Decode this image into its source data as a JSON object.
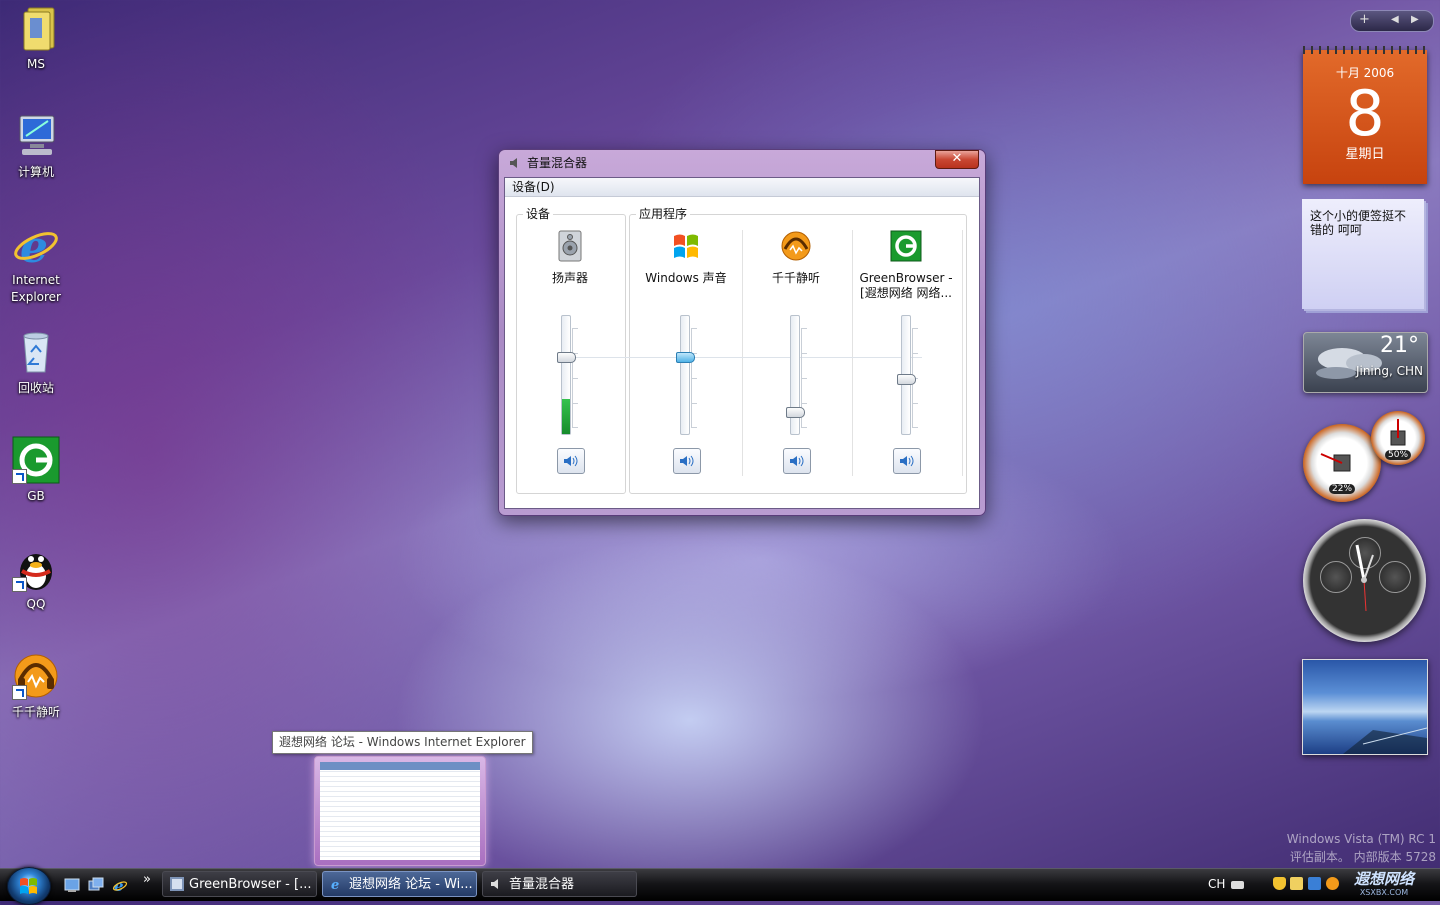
{
  "desktop": {
    "icons": [
      {
        "label": "MS"
      },
      {
        "label": "计算机"
      },
      {
        "label": "Internet Explorer"
      },
      {
        "label": "回收站"
      },
      {
        "label": "GB"
      },
      {
        "label": "QQ"
      },
      {
        "label": "千千静听"
      }
    ]
  },
  "sidebar": {
    "calendar": {
      "month_year": "十月  2006",
      "day": "8",
      "weekday": "星期日"
    },
    "note": {
      "text": "这个小的便签挺不错的   呵呵"
    },
    "weather": {
      "temp": "21°",
      "city": "Jining, CHN"
    },
    "cpu_meter": {
      "cpu": "22%",
      "memory": "50%"
    }
  },
  "mixer": {
    "title": "音量混合器",
    "menu": {
      "device": "设备(D)"
    },
    "groups": {
      "device": "设备",
      "apps": "应用程序"
    },
    "channels": [
      {
        "name": "扬声器",
        "level": 0.3,
        "volume": 0.65
      },
      {
        "name": "Windows 声音",
        "volume": 0.65
      },
      {
        "name": "千千静听",
        "volume": 0.18
      },
      {
        "name": "GreenBrowser - [遐想网络 网络...",
        "volume": 0.46
      }
    ]
  },
  "tooltip": {
    "text": "遐想网络 论坛 - Windows Internet Explorer"
  },
  "watermark": {
    "line1": "Windows Vista (TM) RC 1",
    "line2": "评估副本。 内部版本 5728"
  },
  "taskbar": {
    "overflow": "»",
    "buttons": [
      {
        "label": "GreenBrowser - [..."
      },
      {
        "label": "遐想网络 论坛 - Wi..."
      },
      {
        "label": "音量混合器"
      }
    ],
    "tray": {
      "lang": "CH",
      "logo": "遐想网络",
      "logo_sub": "XSXBX.COM"
    }
  },
  "colors": {
    "accent": "#c7430f",
    "window_frame": "#a98ac4",
    "slider_active": "#4fb2e6",
    "level": "#35c24f"
  }
}
